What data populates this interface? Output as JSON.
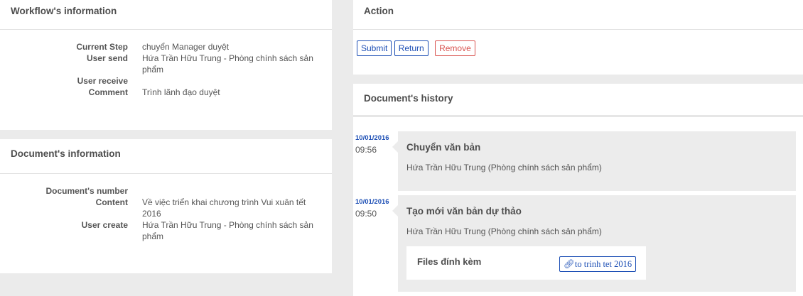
{
  "workflow_info": {
    "title": "Workflow's information",
    "rows": [
      {
        "label": "Current Step",
        "value": "chuyển Manager duyệt"
      },
      {
        "label": "User send",
        "value": "Hứa Trần Hữu Trung - Phòng chính sách sản phẩm"
      },
      {
        "label": "User receive",
        "value": ""
      },
      {
        "label": "Comment",
        "value": "Trình lãnh đạo duyệt"
      }
    ]
  },
  "document_info": {
    "title": "Document's information",
    "rows": [
      {
        "label": "Document's number",
        "value": ""
      },
      {
        "label": "Content",
        "value": "Về việc triển khai chương trình Vui xuân tết 2016"
      },
      {
        "label": "User create",
        "value": "Hứa Trần Hữu Trung - Phòng chính sách sản phẩm"
      }
    ]
  },
  "action": {
    "title": "Action",
    "buttons": {
      "submit": "Submit",
      "return": "Return",
      "remove": "Remove"
    }
  },
  "history": {
    "title": "Document's history",
    "entries": [
      {
        "date": "10/01/2016",
        "time": "09:56",
        "title": "Chuyển văn bản",
        "user": "Hứa Trần Hữu Trung (Phòng chính sách sản phẩm)"
      },
      {
        "date": "10/01/2016",
        "time": "09:50",
        "title": "Tạo mới văn bản dự thảo",
        "user": "Hứa Trần Hữu Trung (Phòng chính sách sản phẩm)",
        "files_label": "Files đính kèm",
        "file_name": "to trinh tet 2016"
      }
    ]
  }
}
